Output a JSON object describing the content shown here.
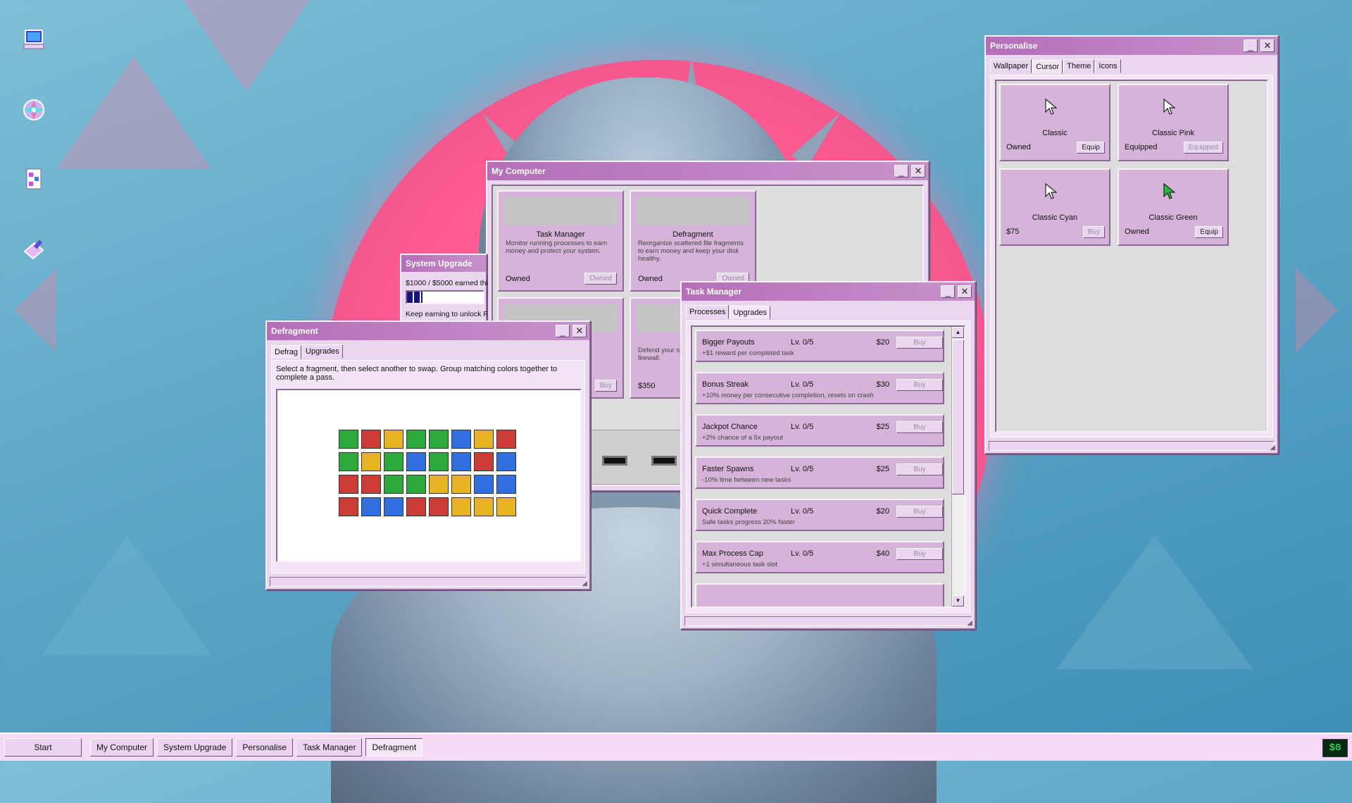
{
  "desktop": {
    "icons": [
      {
        "name": "my-computer-desktop-icon",
        "glyph": "computer"
      },
      {
        "name": "cd-disc-desktop-icon",
        "glyph": "disc"
      },
      {
        "name": "document-desktop-icon",
        "glyph": "document"
      },
      {
        "name": "paint-desktop-icon",
        "glyph": "paint"
      }
    ]
  },
  "my_computer": {
    "title": "My Computer",
    "cards": [
      {
        "name": "Task Manager",
        "desc": "Monitor running processes to earn money and protect your system.",
        "status": "Owned",
        "button": "Owned"
      },
      {
        "name": "Defragment",
        "desc": "Reorganize scattered file fragments to earn money and keep your disk healthy.",
        "status": "Owned",
        "button": "Owned"
      },
      {
        "name": "",
        "desc": "",
        "status": "",
        "button": "Buy"
      },
      {
        "name": "Secu",
        "desc": "Defend your sys malware before firewall.",
        "status": "$350",
        "button": ""
      }
    ]
  },
  "system_upgrade": {
    "title": "System Upgrade",
    "progress_text": "$1000 / $5000 earned thi",
    "progress": 0.2,
    "note": "Keep earning to unlock F"
  },
  "defragment": {
    "title": "Defragment",
    "tabs": [
      "Defrag",
      "Upgrades"
    ],
    "instructions": "Select a fragment, then select another to swap. Group matching colors together to complete a pass.",
    "colors": {
      "G": "#2eaa3c",
      "R": "#d03a34",
      "Y": "#e8b41e",
      "B": "#2f6fe0"
    },
    "grid": [
      [
        "G",
        "R",
        "Y",
        "G",
        "G",
        "B",
        "Y",
        "R"
      ],
      [
        "G",
        "Y",
        "G",
        "B",
        "G",
        "B",
        "R",
        "B"
      ],
      [
        "R",
        "R",
        "G",
        "G",
        "Y",
        "Y",
        "B",
        "B"
      ],
      [
        "R",
        "B",
        "B",
        "R",
        "R",
        "Y",
        "Y",
        "Y"
      ]
    ]
  },
  "task_manager": {
    "title": "Task Manager",
    "tabs": [
      "Processes",
      "Upgrades"
    ],
    "upgrades": [
      {
        "name": "Bigger Payouts",
        "level": "Lv. 0/5",
        "price": "$20",
        "desc": "+$1 reward per completed task",
        "button": "Buy"
      },
      {
        "name": "Bonus Streak",
        "level": "Lv. 0/5",
        "price": "$30",
        "desc": "+10% money per consecutive completion, resets on crash",
        "button": "Buy"
      },
      {
        "name": "Jackpot Chance",
        "level": "Lv. 0/5",
        "price": "$25",
        "desc": "+2% chance of a 5x payout",
        "button": "Buy"
      },
      {
        "name": "Faster Spawns",
        "level": "Lv. 0/5",
        "price": "$25",
        "desc": "-10% time between new tasks",
        "button": "Buy"
      },
      {
        "name": "Quick Complete",
        "level": "Lv. 0/5",
        "price": "$20",
        "desc": "Safe tasks progress 20% faster",
        "button": "Buy"
      },
      {
        "name": "Max Process Cap",
        "level": "Lv. 0/5",
        "price": "$40",
        "desc": "+1 simultaneous task slot",
        "button": "Buy"
      }
    ]
  },
  "personalise": {
    "title": "Personalise",
    "tabs": [
      "Wallpaper",
      "Cursor",
      "Theme",
      "Icons"
    ],
    "cursors": [
      {
        "name": "Classic",
        "status": "Owned",
        "button": "Equip",
        "color": "#ffffff",
        "button_disabled": false
      },
      {
        "name": "Classic Pink",
        "status": "Equipped",
        "button": "Equipped",
        "color": "#ffffff",
        "button_disabled": true
      },
      {
        "name": "Classic Cyan",
        "status": "$75",
        "button": "Buy",
        "color": "#ffffff",
        "button_disabled": true
      },
      {
        "name": "Classic Green",
        "status": "Owned",
        "button": "Equip",
        "color": "#21c23a",
        "button_disabled": false
      }
    ]
  },
  "taskbar": {
    "start": "Start",
    "items": [
      "My Computer",
      "System Upgrade",
      "Personalise",
      "Task Manager",
      "Defragment"
    ],
    "active": "Defragment",
    "money": "$0"
  }
}
